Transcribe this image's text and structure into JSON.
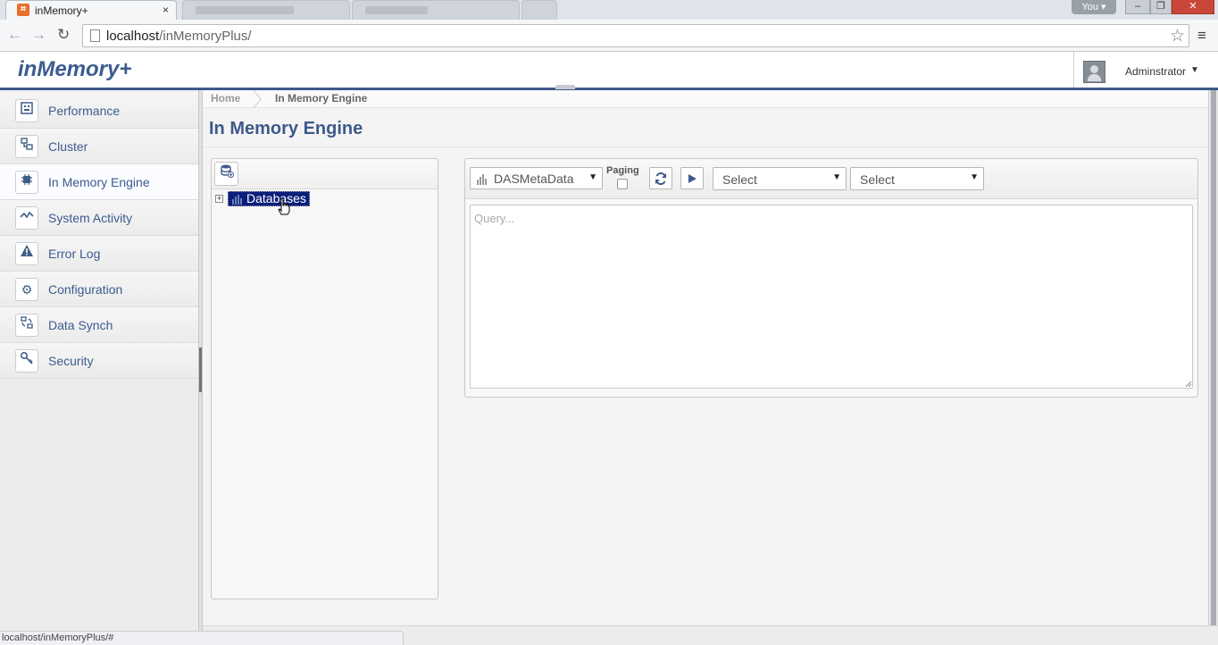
{
  "browser": {
    "tab_title": "inMemory+",
    "tab_close": "×",
    "window_user": "You",
    "url_host": "localhost",
    "url_path": "/inMemoryPlus/",
    "status_url": "localhost/inMemoryPlus/#"
  },
  "header": {
    "brand": "inMemory+",
    "user_name": "Adminstrator"
  },
  "sidebar": {
    "items": [
      {
        "label": "Performance",
        "icon": "dashboard-icon"
      },
      {
        "label": "Cluster",
        "icon": "cluster-icon"
      },
      {
        "label": "In Memory Engine",
        "icon": "chip-icon"
      },
      {
        "label": "System Activity",
        "icon": "activity-icon"
      },
      {
        "label": "Error Log",
        "icon": "warning-icon"
      },
      {
        "label": "Configuration",
        "icon": "gear-icon"
      },
      {
        "label": "Data Synch",
        "icon": "sync-icon"
      },
      {
        "label": "Security",
        "icon": "key-icon"
      }
    ],
    "active_index": 2
  },
  "breadcrumb": {
    "home": "Home",
    "current": "In Memory Engine"
  },
  "page": {
    "title": "In Memory Engine"
  },
  "tree": {
    "root_label": "Databases"
  },
  "query": {
    "datasource": "DASMetaData",
    "paging_label": "Paging",
    "select1": "Select",
    "select2": "Select",
    "placeholder": "Query..."
  },
  "colors": {
    "accent": "#3d5a8a",
    "selection": "#0a1f7a"
  }
}
